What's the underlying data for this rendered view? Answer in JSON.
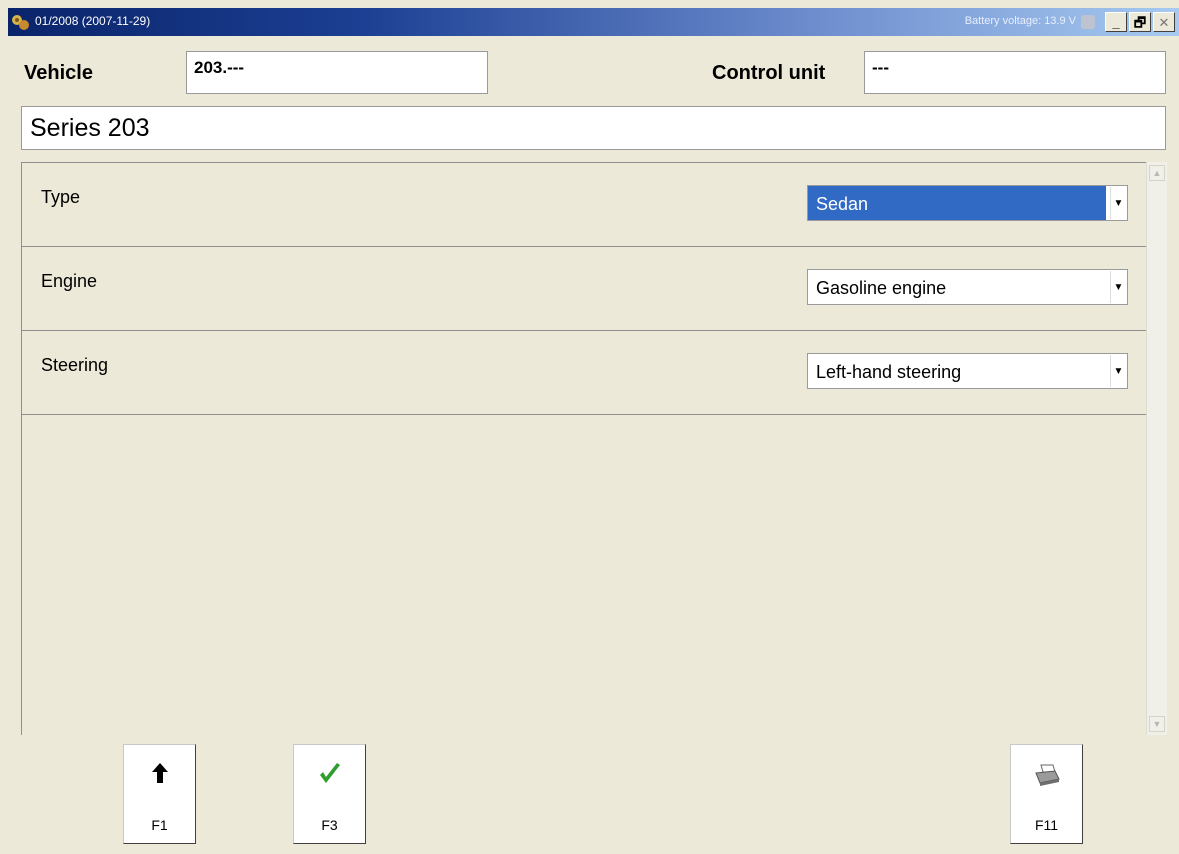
{
  "window": {
    "title": "01/2008 (2007-11-29)",
    "battery_voltage": "Battery voltage: 13.9 V",
    "buttons": {
      "minimize": "_",
      "restore": "🗗",
      "close": "✕"
    }
  },
  "header": {
    "vehicle_label": "Vehicle",
    "vehicle_value": "203.---",
    "control_unit_label": "Control unit",
    "control_unit_value": "---"
  },
  "series": "Series 203",
  "options": [
    {
      "label": "Type",
      "value": "Sedan",
      "selected": true
    },
    {
      "label": "Engine",
      "value": "Gasoline engine",
      "selected": false
    },
    {
      "label": "Steering",
      "value": "Left-hand steering",
      "selected": false
    }
  ],
  "function_keys": [
    {
      "label": "F1",
      "icon": "up-arrow-icon"
    },
    {
      "label": "F3",
      "icon": "checkmark-icon"
    },
    {
      "label": "F11",
      "icon": "printer-icon"
    }
  ],
  "colors": {
    "selection": "#316ac5",
    "title_bar_start": "#0a246a",
    "title_bar_end": "#a6caf0",
    "checkmark": "#2e9e2e",
    "background": "#ece9d8"
  }
}
